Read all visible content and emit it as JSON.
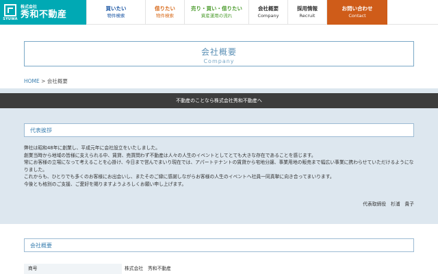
{
  "logo": {
    "mark_text": "SYUWA",
    "sub": "株式会社",
    "name": "秀和不動産"
  },
  "nav": [
    {
      "top": "買いたい",
      "bottom": "物件検索",
      "color": "#1a55a3",
      "width": 86
    },
    {
      "top": "借りたい",
      "bottom": "物件検索",
      "color": "#d86b1c",
      "width": 57
    },
    {
      "top": "売り・買い・借りたい",
      "bottom": "資産運用の流れ",
      "color": "#4c9c2e",
      "width": 94
    },
    {
      "top": "会社概要",
      "bottom": "Company",
      "color": "#333333",
      "width": 57
    },
    {
      "top": "採用情報",
      "bottom": "Recruit",
      "color": "#333333",
      "width": 57
    },
    {
      "top": "お問い合わせ",
      "bottom": "Contact",
      "color": "#ffffff",
      "width": 89
    }
  ],
  "page": {
    "title_jp": "会社概要",
    "title_en": "Company"
  },
  "breadcrumb": {
    "home": "HOME",
    "sep": ">",
    "current": "会社概要"
  },
  "banner": "不動産のことなら株式会社秀和不動産へ",
  "greeting": {
    "title": "代表挨拶",
    "lines": [
      "弊社は昭和48年に創業し、平成元年に会社設立をいたしました。",
      "創業当時から地域の皆様に支えられる中、賃貸、売買問わず不動産は人々の人生のイベントとしてとても大きな存在であることを感じます。",
      "常にお客様の立場になって考えることを心掛け、今日まで営んでまいり現在では、アパートテナントの賃貸から宅地分譲、事業用地の販売まで幅広い事業に携わらせていただけるようになりました。",
      "これからも、ひとりでも多くのお客様にお出会いし、またそのご縁に感謝しながらお客様の人生のイベントへ社員一同真摯に向き合ってまいります。",
      "今後とも格別のご支援、ご愛好を賜りますようよろしくお願い申し上げます。"
    ],
    "signature": "代表取締役　杉浦　貴子"
  },
  "overview": {
    "title": "会社概要",
    "rows": [
      {
        "label": "商号",
        "value": "株式会社　秀和不動産"
      }
    ]
  }
}
